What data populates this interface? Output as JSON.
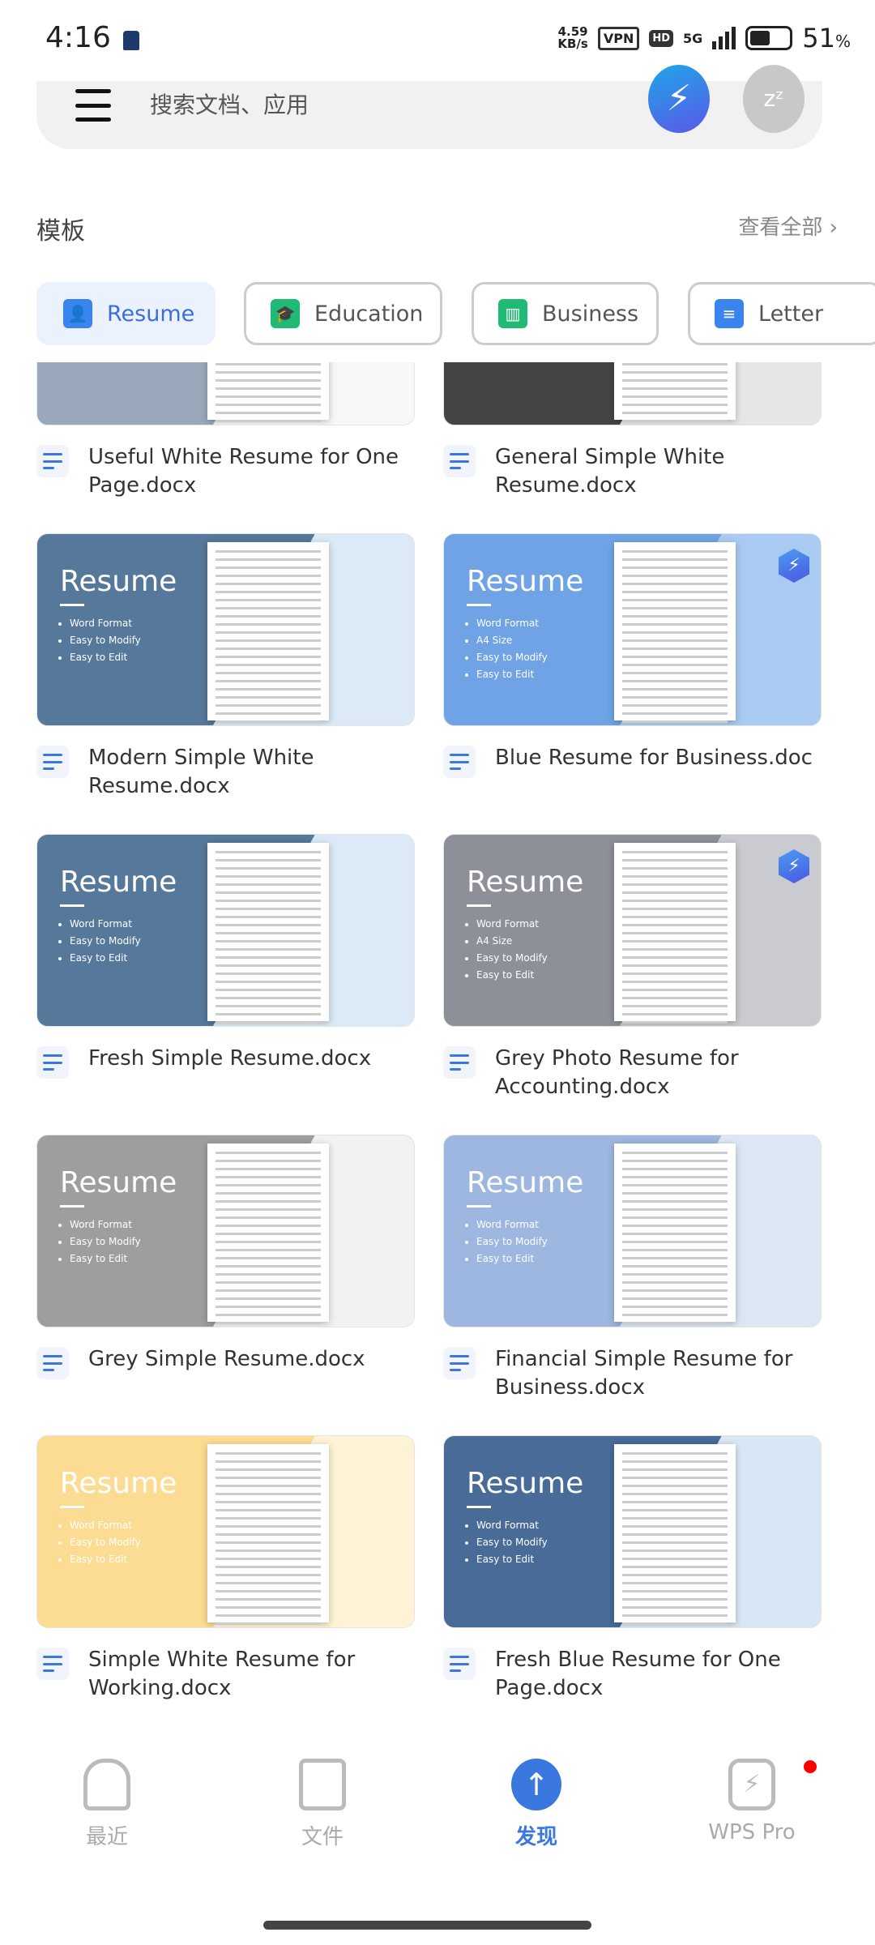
{
  "status": {
    "time": "4:16",
    "speed_value": "4.59",
    "speed_unit": "KB/s",
    "vpn": "VPN",
    "hd": "HD",
    "network": "5G",
    "battery": "51",
    "battery_unit": "%"
  },
  "search": {
    "placeholder": "搜索文档、应用"
  },
  "section": {
    "title": "模板",
    "see_all": "查看全部"
  },
  "chips": [
    {
      "label": "Resume",
      "color": "#3a84f0",
      "active": true
    },
    {
      "label": "Education",
      "color": "#1fba74"
    },
    {
      "label": "Business",
      "color": "#1fba74"
    },
    {
      "label": "Letter",
      "color": "#3a84f0"
    }
  ],
  "thumb_text": {
    "resume": "Resume",
    "b1": "Word Format",
    "b2": "Easy to Modify",
    "b3": "Easy to Edit",
    "b_a4": "A4 Size"
  },
  "templates": [
    {
      "title": "Useful White Resume for One Page.docx"
    },
    {
      "title": "General Simple White Resume.docx"
    },
    {
      "title": "Modern Simple White Resume.docx"
    },
    {
      "title": "Blue Resume for Business.doc",
      "premium": true
    },
    {
      "title": "Fresh Simple Resume.docx"
    },
    {
      "title": "Grey Photo Resume for Accounting.docx",
      "premium": true
    },
    {
      "title": "Grey Simple Resume.docx"
    },
    {
      "title": "Financial Simple Resume for Business.docx"
    },
    {
      "title": "Simple White Resume for Working.docx"
    },
    {
      "title": "Fresh Blue Resume for One Page.docx"
    }
  ],
  "nav": [
    {
      "label": "最近"
    },
    {
      "label": "文件"
    },
    {
      "label": "发现",
      "active": true
    },
    {
      "label": "WPS Pro",
      "notification": true
    }
  ]
}
